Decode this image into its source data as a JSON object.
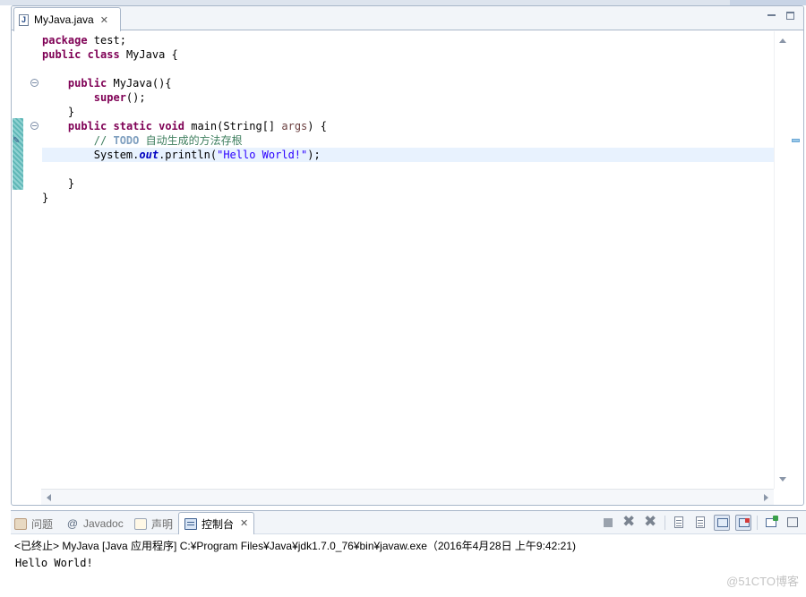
{
  "editor": {
    "tab": {
      "label": "MyJava.java",
      "icon_text": "J",
      "close_glyph": "✕"
    },
    "minimize_icon": "minimize-icon",
    "maximize_icon": "maximize-icon",
    "code_lines": [
      [
        {
          "c": "kw",
          "t": "package"
        },
        {
          "c": "",
          "t": " test;"
        }
      ],
      [
        {
          "c": "kw",
          "t": "public"
        },
        {
          "c": "",
          "t": " "
        },
        {
          "c": "kw",
          "t": "class"
        },
        {
          "c": "",
          "t": " MyJava {"
        }
      ],
      [],
      [
        {
          "c": "",
          "t": "    "
        },
        {
          "c": "kw",
          "t": "public"
        },
        {
          "c": "",
          "t": " MyJava(){"
        }
      ],
      [
        {
          "c": "",
          "t": "        "
        },
        {
          "c": "kw",
          "t": "super"
        },
        {
          "c": "",
          "t": "();"
        }
      ],
      [
        {
          "c": "",
          "t": "    }"
        }
      ],
      [
        {
          "c": "",
          "t": "    "
        },
        {
          "c": "kw",
          "t": "public"
        },
        {
          "c": "",
          "t": " "
        },
        {
          "c": "kw",
          "t": "static"
        },
        {
          "c": "",
          "t": " "
        },
        {
          "c": "kw",
          "t": "void"
        },
        {
          "c": "",
          "t": " main(String[] "
        },
        {
          "c": "par",
          "t": "args"
        },
        {
          "c": "",
          "t": ") {"
        }
      ],
      [
        {
          "c": "",
          "t": "        "
        },
        {
          "c": "cm",
          "t": "// "
        },
        {
          "c": "todo",
          "t": "TODO"
        },
        {
          "c": "cm",
          "t": " 自动生成的方法存根"
        }
      ],
      [
        {
          "c": "",
          "t": "        System."
        },
        {
          "c": "fld",
          "t": "out"
        },
        {
          "c": "",
          "t": ".println("
        },
        {
          "c": "st",
          "t": "\"Hello World!\""
        },
        {
          "c": "",
          "t": ");"
        }
      ],
      [],
      [
        {
          "c": "",
          "t": "    }"
        }
      ],
      [
        {
          "c": "",
          "t": "}"
        }
      ]
    ],
    "current_line_index": 8
  },
  "views": {
    "tabs": [
      {
        "label": "问题",
        "icon": "problems-icon",
        "active": false
      },
      {
        "label": "Javadoc",
        "icon": "javadoc-icon",
        "glyph": "@",
        "active": false
      },
      {
        "label": "声明",
        "icon": "declaration-icon",
        "active": false
      },
      {
        "label": "控制台",
        "icon": "console-icon",
        "active": true,
        "close_glyph": "✕"
      }
    ],
    "console": {
      "header": "<已终止> MyJava [Java 应用程序] C:¥Program Files¥Java¥jdk1.7.0_76¥bin¥javaw.exe（2016年4月28日 上午9:42:21)",
      "output": "Hello World!"
    },
    "x_glyph": "✖",
    "xx_glyph": "✖"
  },
  "watermark": "@51CTO博客",
  "colors": {
    "keyword": "#7f0055",
    "comment": "#3f7f5f",
    "string": "#2a00ff",
    "field": "#0000c0",
    "current_line": "#e8f2fe",
    "border": "#a9b7c9"
  }
}
